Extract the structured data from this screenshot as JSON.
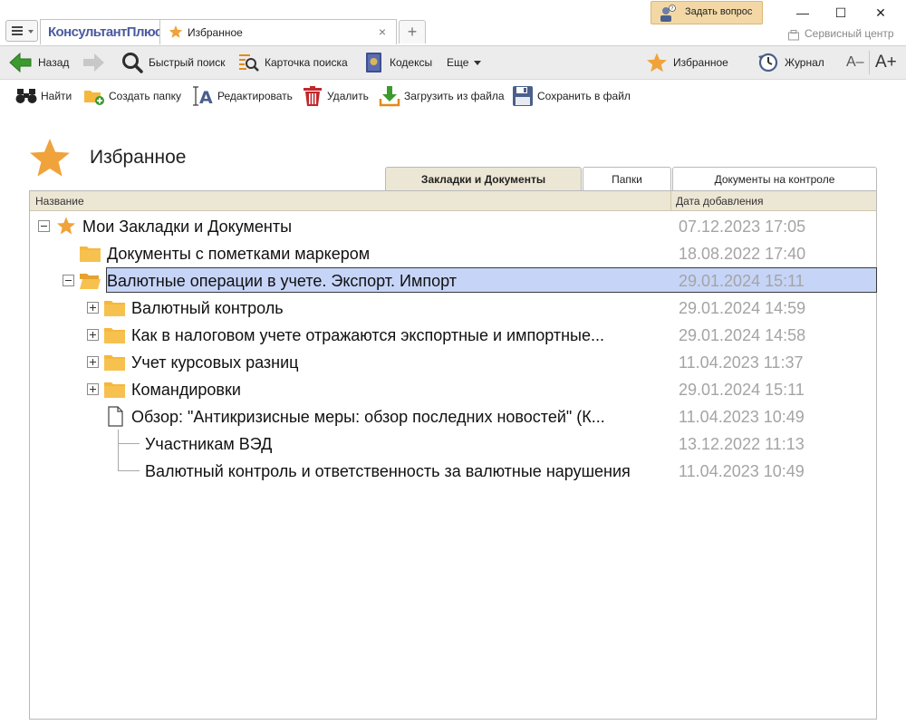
{
  "window": {
    "logo": "КонсультантПлюс",
    "tab_label": "Избранное",
    "tab_close": "×",
    "new_tab": "+",
    "ask_label": "Задать вопрос",
    "service_label": "Сервисный центр",
    "minimize": "—",
    "maximize": "☐",
    "close": "✕"
  },
  "nav": {
    "back": "Назад",
    "quick_search": "Быстрый поиск",
    "search_card": "Карточка поиска",
    "codes": "Кодексы",
    "more": "Еще",
    "favorites": "Избранное",
    "journal": "Журнал",
    "font_smaller": "A–",
    "font_larger": "A+"
  },
  "actions": {
    "find": "Найти",
    "create_folder": "Создать папку",
    "edit": "Редактировать",
    "delete": "Удалить",
    "load_file": "Загрузить из файла",
    "save_file": "Сохранить в файл"
  },
  "page": {
    "title": "Избранное"
  },
  "tabs": [
    {
      "label": "Закладки и Документы",
      "active": true
    },
    {
      "label": "Папки",
      "active": false
    },
    {
      "label": "Документы на контроле",
      "active": false
    }
  ],
  "table": {
    "col_name": "Название",
    "col_date": "Дата добавления",
    "rows": [
      {
        "label": "Мои Закладки и Документы",
        "date": "07.12.2023 17:05"
      },
      {
        "label": "Документы с пометками маркером",
        "date": "18.08.2022 17:40"
      },
      {
        "label": "Валютные операции в учете. Экспорт. Импорт",
        "date": "29.01.2024 15:11"
      },
      {
        "label": "Валютный контроль",
        "date": "29.01.2024 14:59"
      },
      {
        "label": "Как в налоговом учете отражаются экспортные и импортные...",
        "date": "29.01.2024 14:58"
      },
      {
        "label": "Учет курсовых разниц",
        "date": "11.04.2023 11:37"
      },
      {
        "label": "Командировки",
        "date": "29.01.2024 15:11"
      },
      {
        "label": "Обзор: \"Антикризисные меры: обзор последних новостей\" (К...",
        "date": "11.04.2023 10:49"
      },
      {
        "label": "Участникам ВЭД",
        "date": "13.12.2022 11:13"
      },
      {
        "label": "Валютный контроль и ответственность за валютные нарушения",
        "date": "11.04.2023 10:49"
      }
    ]
  },
  "colors": {
    "accent_star": "#f0a23b",
    "folder": "#f5b83d",
    "selection": "#c6d4f7",
    "header_bg": "#ece6d4"
  }
}
